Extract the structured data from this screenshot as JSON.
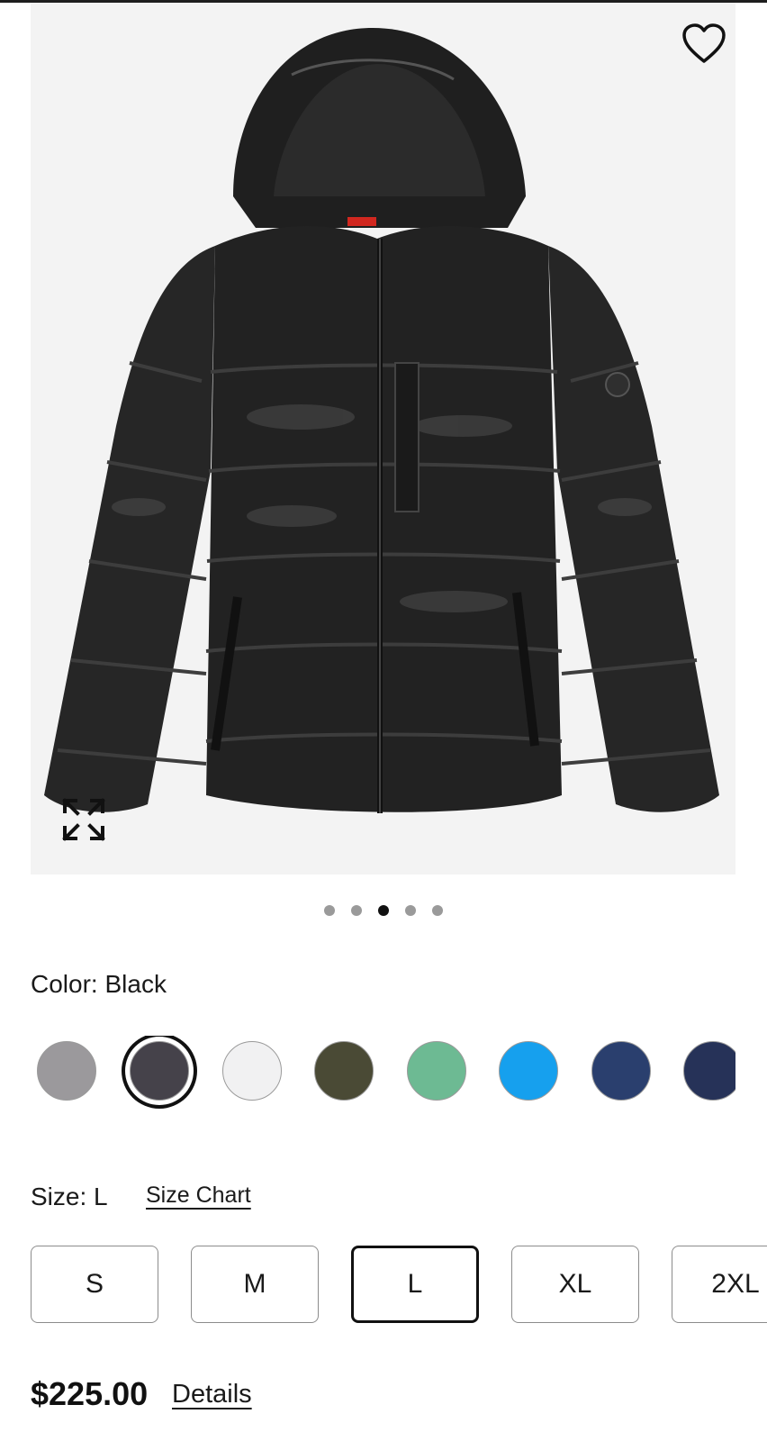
{
  "product": {
    "image_alt": "Black hooded puffer jacket",
    "wishlist_icon": "heart-outline-icon",
    "expand_icon": "expand-arrows-icon",
    "carousel": {
      "total": 5,
      "active_index": 2
    }
  },
  "color": {
    "label": "Color: Black",
    "selected_index": 1,
    "swatches": [
      {
        "hex": "#9b999c"
      },
      {
        "hex": "#45424a"
      },
      {
        "hex": "#f1f1f2"
      },
      {
        "hex": "#4a4a35"
      },
      {
        "hex": "#6dba93"
      },
      {
        "hex": "#16a0ee"
      },
      {
        "hex": "#2a3f6e"
      },
      {
        "hex": "#263258"
      }
    ]
  },
  "size": {
    "label": "Size: L",
    "chart_link": "Size Chart",
    "options": [
      "S",
      "M",
      "L",
      "XL",
      "2XL"
    ],
    "selected_index": 2
  },
  "price": {
    "amount": "$225.00",
    "details_link": "Details"
  }
}
